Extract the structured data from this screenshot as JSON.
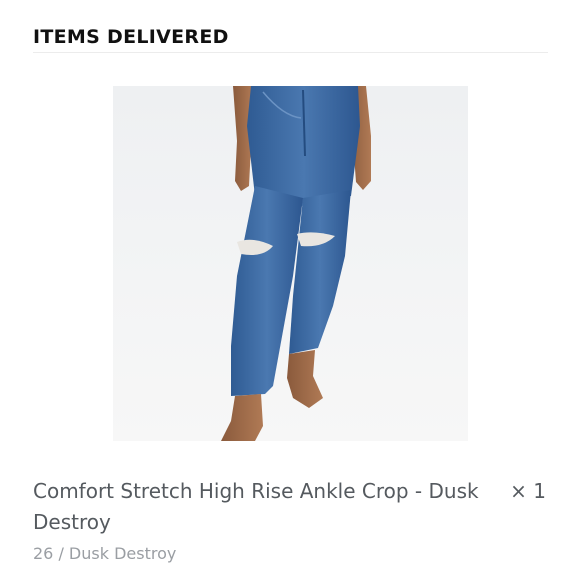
{
  "section": {
    "title": "ITEMS DELIVERED"
  },
  "item": {
    "image_subject": "jeans-product-photo",
    "name": "Comfort Stretch High Rise Ankle Crop - Dusk Destroy",
    "quantity": "× 1",
    "variant": "26 / Dusk Destroy"
  },
  "colors": {
    "denim": "#3d6aa3",
    "title_text": "#111111",
    "name_text": "#555a5f",
    "variant_text": "#9a9ea3"
  }
}
